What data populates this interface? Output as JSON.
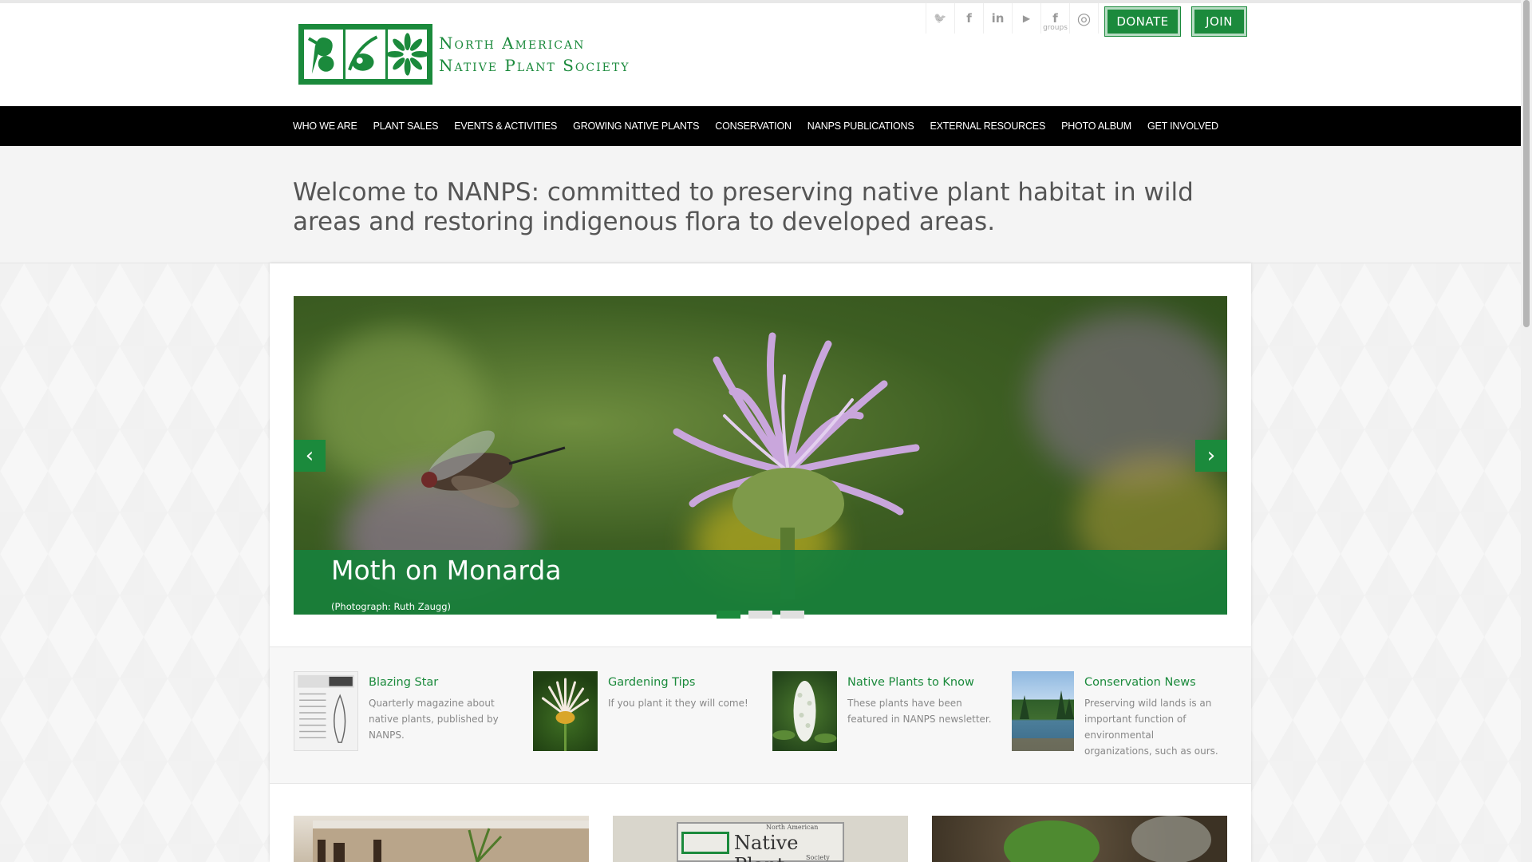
{
  "logo": {
    "line1": "North American",
    "line2": "Native Plant Society"
  },
  "social": [
    {
      "name": "twitter-icon",
      "glyph": "🐦"
    },
    {
      "name": "facebook-icon",
      "glyph": "f"
    },
    {
      "name": "linkedin-icon",
      "glyph": "in"
    },
    {
      "name": "youtube-icon",
      "glyph": "▶"
    },
    {
      "name": "facebook-groups-icon",
      "glyph": "f",
      "sub": "groups"
    },
    {
      "name": "instagram-icon",
      "glyph": "◎"
    }
  ],
  "buttons": {
    "donate": "DONATE",
    "join": "JOIN"
  },
  "nav": [
    "WHO WE ARE",
    "PLANT SALES",
    "EVENTS & ACTIVITIES",
    "GROWING NATIVE PLANTS",
    "CONSERVATION",
    "NANPS PUBLICATIONS",
    "EXTERNAL RESOURCES",
    "PHOTO ALBUM",
    "GET INVOLVED"
  ],
  "welcome": "Welcome to NANPS: committed to preserving native plant habitat in wild areas and restoring indigenous flora to developed areas.",
  "slider": {
    "title": "Moth on Monarda",
    "credit": "(Photograph: Ruth Zaugg)",
    "prev": "‹",
    "next": "›",
    "active_slide": 1,
    "slide_count": 3
  },
  "features": [
    {
      "title": "Blazing Star",
      "desc": "Quarterly magazine about native plants, published by NANPS."
    },
    {
      "title": "Gardening Tips",
      "desc": "If you plant it they will come!"
    },
    {
      "title": "Native Plants to Know",
      "desc": "These plants have been featured in NANPS newsletter."
    },
    {
      "title": "Conservation News",
      "desc": "Preserving wild lands is an important function of environmental organizations, such as ours."
    }
  ],
  "tiles": {
    "banner_line1": "North American",
    "banner_main": "Native Plant",
    "banner_sub": "Society"
  },
  "colors": {
    "brand_green": "#1b8a3c",
    "nav_bg": "#000000"
  }
}
